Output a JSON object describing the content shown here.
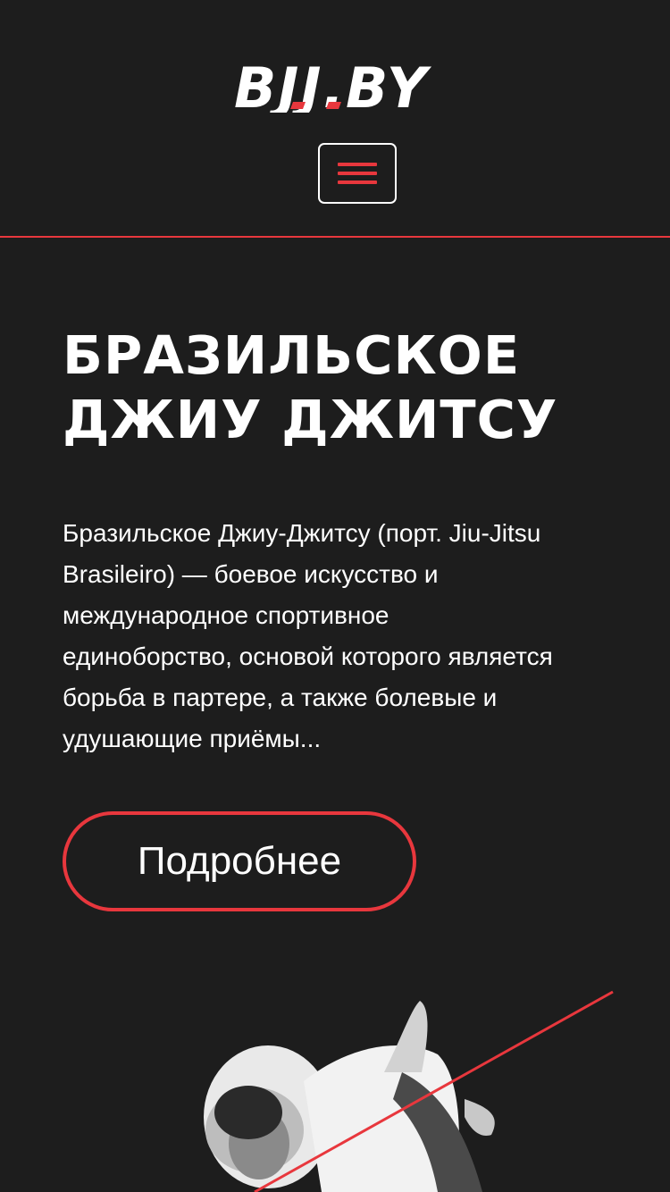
{
  "header": {
    "logo_text": "BJJ.BY",
    "menu_button_icon": "hamburger-menu-icon"
  },
  "hero": {
    "title_lines": [
      "БРАЗИЛЬСКОЕ",
      "ДЖИУ ДЖИТСУ"
    ],
    "description_lines": [
      "Бразильское Джиу-Джитсу (порт. Jiu-Jitsu",
      "Brasileiro) — боевое искусство и",
      "международное спортивное",
      "единоборство, основой которого является",
      "борьба в партере, а также болевые и",
      "удушающие приёмы..."
    ],
    "more_button_label": "Подробнее",
    "image": "bjj-athlete-photo"
  },
  "colors": {
    "background": "#1d1d1d",
    "accent": "#e8373d",
    "text": "#ffffff"
  }
}
